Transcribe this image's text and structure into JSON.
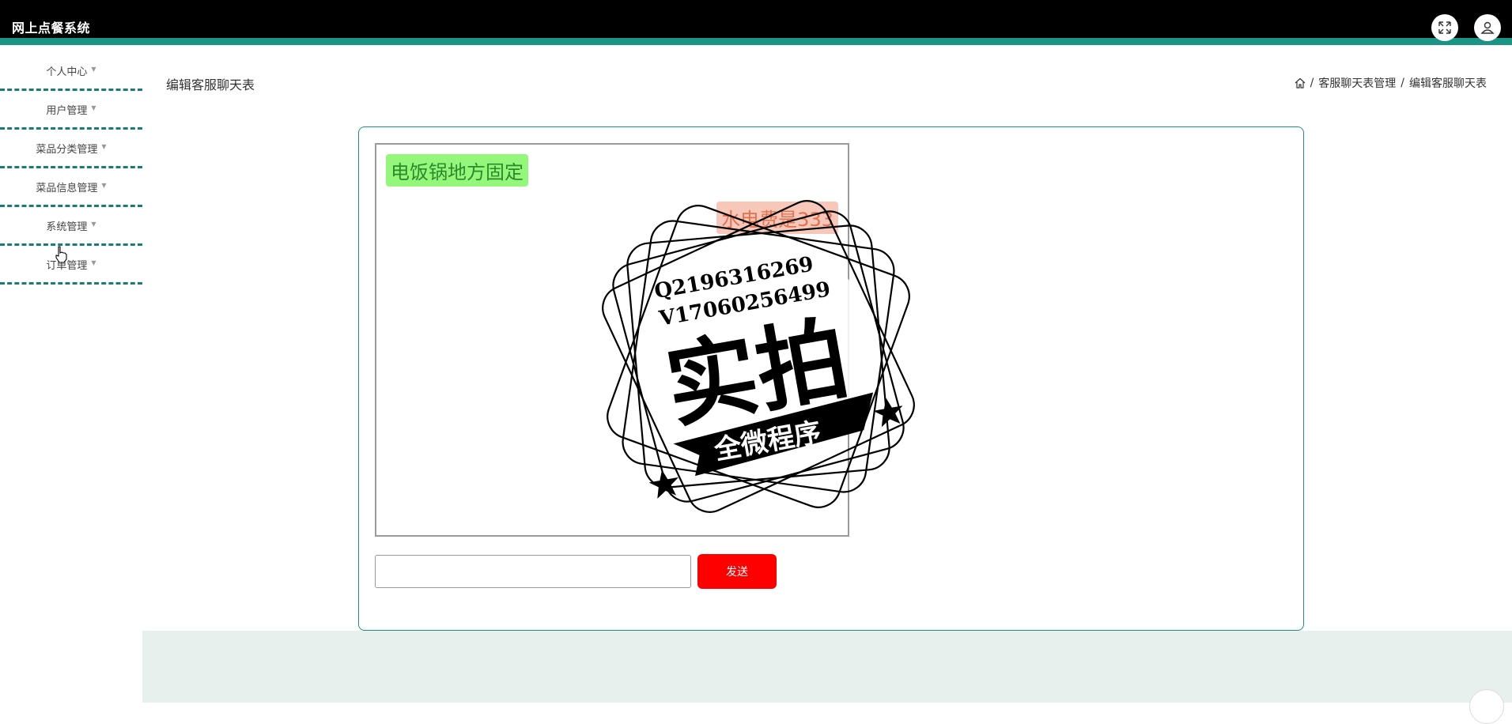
{
  "app": {
    "title": "网上点餐系统"
  },
  "header": {
    "fullscreen_icon": "expand-arrows-icon",
    "user_icon": "user-icon"
  },
  "sidebar": {
    "items": [
      {
        "label": "个人中心"
      },
      {
        "label": "用户管理"
      },
      {
        "label": "菜品分类管理"
      },
      {
        "label": "菜品信息管理"
      },
      {
        "label": "系统管理"
      },
      {
        "label": "订单管理"
      }
    ]
  },
  "page": {
    "title": "编辑客服聊天表"
  },
  "breadcrumb": {
    "home_icon": "home-icon",
    "items": [
      "客服聊天表管理",
      "编辑客服聊天表"
    ],
    "separator": "/"
  },
  "chat": {
    "messages": [
      {
        "side": "left",
        "text": "电饭锅地方固定"
      },
      {
        "side": "right",
        "text": "水电费是333"
      }
    ],
    "input_value": "",
    "send_label": "发送"
  },
  "watermark": {
    "line1": "Q2196316269",
    "line2": "V17060256499",
    "big": "实拍",
    "ribbon": "全微程序"
  },
  "colors": {
    "accent": "#1a9485",
    "header_bg": "#000000",
    "send_button": "#ff0000",
    "left_bubble": "#94f77c",
    "right_bubble": "#f7c3b3"
  }
}
